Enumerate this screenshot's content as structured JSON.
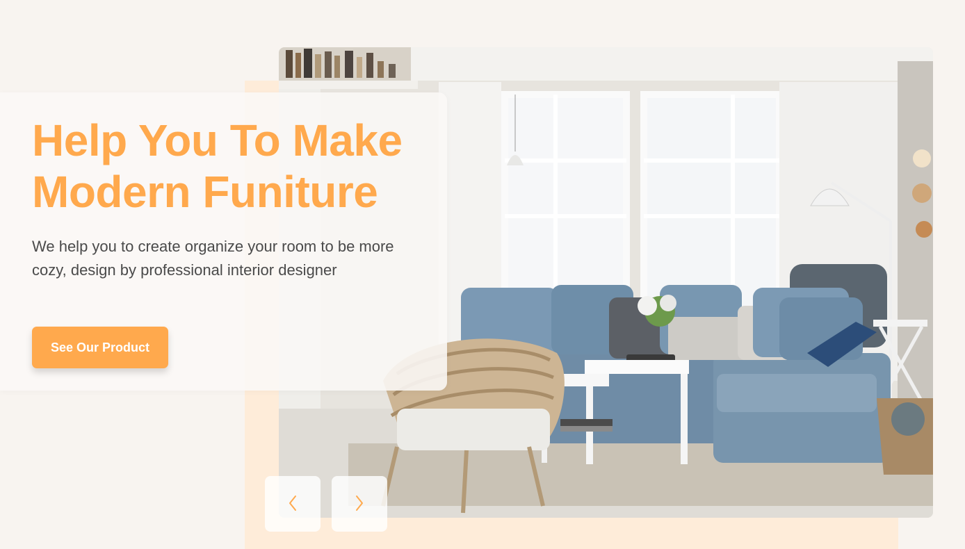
{
  "hero": {
    "title_line1": "Help You To Make",
    "title_line2": "Modern Funiture",
    "description": "We help you to create organize your room to be more cozy, design by professional interior designer",
    "cta_label": "See Our Product"
  },
  "carousel": {
    "prev_icon": "chevron-left-icon",
    "next_icon": "chevron-right-icon"
  },
  "colors": {
    "accent": "#ffa94d",
    "background": "#f8f4f0",
    "backdrop": "#feecd9",
    "text": "#4a4a4a"
  }
}
